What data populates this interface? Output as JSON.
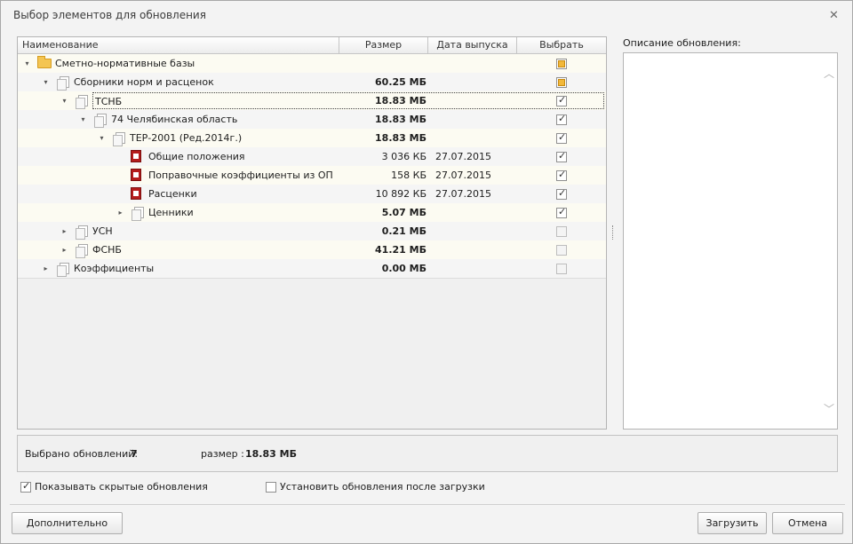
{
  "window": {
    "title": "Выбор элементов для обновления",
    "close_glyph": "✕"
  },
  "grid": {
    "columns": {
      "name": "Наименование",
      "size": "Размер",
      "date": "Дата выпуска",
      "select": "Выбрать"
    },
    "rows": [
      {
        "label": "Сметно-нормативные базы",
        "size": "",
        "size_bold": false,
        "date": "",
        "check": "indeterminate",
        "icon": "folder-icon",
        "expander": "expanded"
      },
      {
        "label": "Сборники норм и расценок",
        "size": "60.25 МБ",
        "size_bold": true,
        "date": "",
        "check": "indeterminate",
        "icon": "collection-icon",
        "expander": "expanded"
      },
      {
        "label": "ТСНБ",
        "size": "18.83 МБ",
        "size_bold": true,
        "date": "",
        "check": "checked",
        "icon": "collection-icon",
        "expander": "expanded",
        "focused": true
      },
      {
        "label": "74 Челябинская область",
        "size": "18.83 МБ",
        "size_bold": true,
        "date": "",
        "check": "checked",
        "icon": "collection-icon",
        "expander": "expanded"
      },
      {
        "label": "ТЕР-2001 (Ред.2014г.)",
        "size": "18.83 МБ",
        "size_bold": true,
        "date": "",
        "check": "checked",
        "icon": "collection-icon",
        "expander": "expanded"
      },
      {
        "label": "Общие положения",
        "size": "3 036 КБ",
        "size_bold": false,
        "date": "27.07.2015",
        "check": "checked",
        "icon": "document-icon",
        "expander": "none"
      },
      {
        "label": "Поправочные коэффициенты из ОП",
        "size": "158 КБ",
        "size_bold": false,
        "date": "27.07.2015",
        "check": "checked",
        "icon": "document-icon",
        "expander": "none"
      },
      {
        "label": "Расценки",
        "size": "10 892 КБ",
        "size_bold": false,
        "date": "27.07.2015",
        "check": "checked",
        "icon": "document-icon",
        "expander": "none"
      },
      {
        "label": "Ценники",
        "size": "5.07 МБ",
        "size_bold": true,
        "date": "",
        "check": "checked",
        "icon": "collection-icon",
        "expander": "collapsed"
      },
      {
        "label": "УСН",
        "size": "0.21 МБ",
        "size_bold": true,
        "date": "",
        "check": "disabled",
        "icon": "collection-icon",
        "expander": "collapsed"
      },
      {
        "label": "ФСНБ",
        "size": "41.21 МБ",
        "size_bold": true,
        "date": "",
        "check": "disabled",
        "icon": "collection-icon",
        "expander": "collapsed"
      },
      {
        "label": "Коэффициенты",
        "size": "0.00 МБ",
        "size_bold": true,
        "date": "",
        "check": "disabled",
        "icon": "collection-icon",
        "expander": "collapsed"
      }
    ]
  },
  "description": {
    "label": "Описание обновления:"
  },
  "summary": {
    "selected_label": "Выбрано обновлений:",
    "selected_count": "7",
    "size_label": "размер :",
    "size_value": "18.83 МБ"
  },
  "options": {
    "show_hidden": {
      "label": "Показывать скрытые обновления",
      "checked": true
    },
    "install_after": {
      "label": "Установить обновления после загрузки",
      "checked": false
    }
  },
  "buttons": {
    "advanced": "Дополнительно",
    "download": "Загрузить",
    "cancel": "Отмена"
  }
}
